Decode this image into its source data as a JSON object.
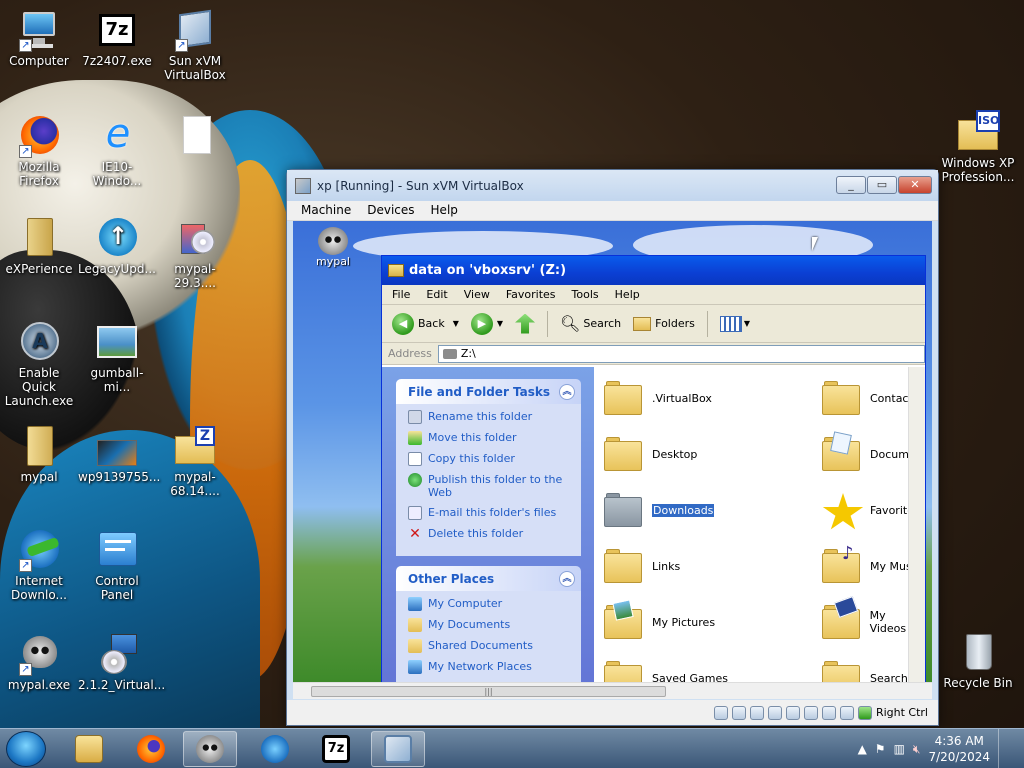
{
  "desktop": {
    "icons_left": [
      {
        "label": "Computer",
        "icon": "computer-icon"
      },
      {
        "label": "7z2407.exe",
        "icon": "7zip-icon"
      },
      {
        "label": "Sun xVM VirtualBox",
        "icon": "virtualbox-icon"
      },
      {
        "label": "Mozilla Firefox",
        "icon": "firefox-icon"
      },
      {
        "label": "IE10-Windo...",
        "icon": "internet-explorer-icon"
      },
      {
        "label": "",
        "icon": "blank-file-icon"
      },
      {
        "label": "eXPerience",
        "icon": "folder-icon"
      },
      {
        "label": "LegacyUpd...",
        "icon": "legacy-update-icon"
      },
      {
        "label": "mypal-29.3....",
        "icon": "installer-cd-icon"
      },
      {
        "label": "Enable Quick Launch.exe",
        "icon": "quick-launch-icon"
      },
      {
        "label": "gumball-mi...",
        "icon": "image-file-icon"
      },
      {
        "label": "mypal",
        "icon": "folder-icon"
      },
      {
        "label": "wp9139755...",
        "icon": "image-file-icon"
      },
      {
        "label": "mypal-68.14....",
        "icon": "zip-folder-icon"
      },
      {
        "label": "Internet Downlo...",
        "icon": "internet-download-manager-icon"
      },
      {
        "label": "Control Panel",
        "icon": "control-panel-icon"
      },
      {
        "label": "mypal.exe",
        "icon": "mypal-raccoon-icon"
      },
      {
        "label": "2.1.2_Virtual...",
        "icon": "virtualbox-setup-icon"
      }
    ],
    "icons_right": [
      {
        "label": "Windows XP Profession...",
        "icon": "iso-file-icon"
      },
      {
        "label": "Recycle Bin",
        "icon": "recycle-bin-icon"
      }
    ]
  },
  "vbox": {
    "title": "xp [Running] - Sun xVM VirtualBox",
    "menu": [
      "Machine",
      "Devices",
      "Help"
    ],
    "host_key": "Right Ctrl",
    "scroll_grip": "|||"
  },
  "guest": {
    "desktop_icon_label": "mypal",
    "explorer": {
      "title": "data on 'vboxsrv' (Z:)",
      "menu": [
        "File",
        "Edit",
        "View",
        "Favorites",
        "Tools",
        "Help"
      ],
      "toolbar": {
        "back": "Back",
        "search": "Search",
        "folders": "Folders"
      },
      "address_label": "Address",
      "address_value": "Z:\\",
      "file_tasks": {
        "title": "File and Folder Tasks",
        "items": [
          "Rename this folder",
          "Move this folder",
          "Copy this folder",
          "Publish this folder to the Web",
          "E-mail this folder's files",
          "Delete this folder"
        ]
      },
      "other_places": {
        "title": "Other Places",
        "items": [
          "My Computer",
          "My Documents",
          "Shared Documents",
          "My Network Places"
        ]
      },
      "files": [
        {
          "name": ".VirtualBox",
          "kind": "folder"
        },
        {
          "name": "Contacts",
          "kind": "folder"
        },
        {
          "name": "Desktop",
          "kind": "folder"
        },
        {
          "name": "Documents",
          "kind": "documents-folder"
        },
        {
          "name": "Downloads",
          "kind": "gray-folder",
          "selected": true
        },
        {
          "name": "Favorites",
          "kind": "favorites-star"
        },
        {
          "name": "Links",
          "kind": "folder"
        },
        {
          "name": "My Music",
          "kind": "music-folder"
        },
        {
          "name": "My Pictures",
          "kind": "pictures-folder"
        },
        {
          "name": "My Videos",
          "kind": "videos-folder"
        },
        {
          "name": "Saved Games",
          "kind": "folder"
        },
        {
          "name": "Searches",
          "kind": "folder"
        }
      ]
    }
  },
  "taskbar": {
    "items": [
      "explorer",
      "firefox",
      "mypal",
      "internet-download-manager",
      "7zip",
      "virtualbox"
    ],
    "time": "4:36 AM",
    "date": "7/20/2024"
  },
  "colors": {
    "xp_title": "#0a5bec",
    "xp_task_link": "#215dc6",
    "selection": "#316ac5"
  }
}
